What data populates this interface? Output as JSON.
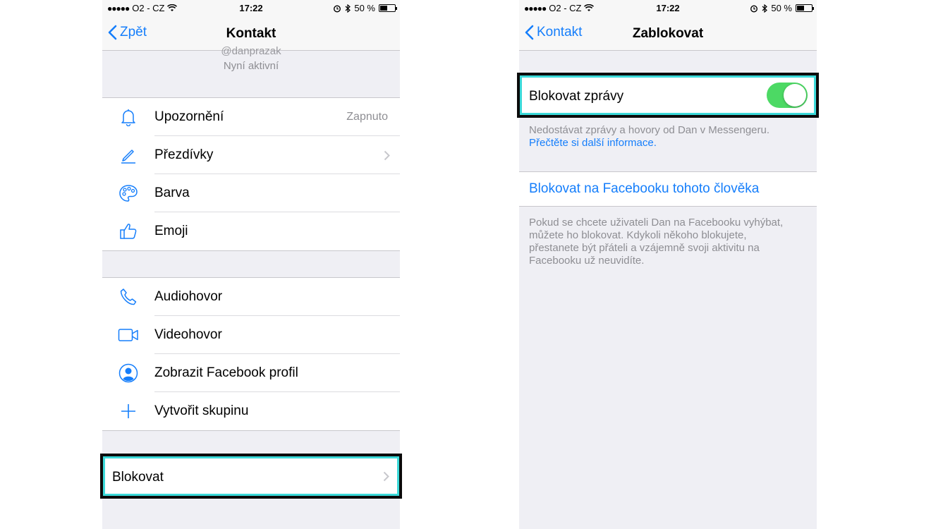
{
  "accent": "#157efb",
  "toggle_on_color": "#4cd964",
  "highlight_color": "#3cd9d9",
  "status_bar": {
    "signal": "●●●●●",
    "carrier": "O2 - CZ",
    "time": "17:22",
    "battery": "50 %"
  },
  "left": {
    "nav": {
      "back": "Zpět",
      "title": "Kontakt"
    },
    "profile": {
      "handle": "@danprazak",
      "status": "Nyní aktivní"
    },
    "group1": [
      {
        "label": "Upozornění",
        "value": "Zapnuto",
        "icon": "bell-icon"
      },
      {
        "label": "Přezdívky",
        "icon": "pencil-icon"
      },
      {
        "label": "Barva",
        "icon": "palette-icon"
      },
      {
        "label": "Emoji",
        "icon": "thumbs-up-icon"
      }
    ],
    "group2": [
      {
        "label": "Audiohovor",
        "icon": "phone-icon"
      },
      {
        "label": "Videohovor",
        "icon": "video-camera-icon"
      },
      {
        "label": "Zobrazit Facebook profil",
        "icon": "profile-icon"
      },
      {
        "label": "Vytvořit skupinu",
        "icon": "plus-icon"
      }
    ],
    "block_row": {
      "label": "Blokovat"
    }
  },
  "right": {
    "nav": {
      "back": "Kontakt",
      "title": "Zablokovat"
    },
    "block_messages": {
      "label": "Blokovat zprávy",
      "enabled": true
    },
    "note1": {
      "text": "Nedostávat zprávy a hovory od Dan v Messengeru.",
      "link": "Přečtěte si další informace."
    },
    "facebook_block": {
      "label": "Blokovat na Facebooku tohoto člověka"
    },
    "note2": {
      "lines": [
        "Pokud se chcete uživateli Dan na Facebooku vyhýbat,",
        "můžete ho blokovat. Kdykoli někoho blokujete,",
        "přestanete být přáteli a vzájemně svoji aktivitu na",
        "Facebooku už neuvidíte."
      ]
    }
  }
}
